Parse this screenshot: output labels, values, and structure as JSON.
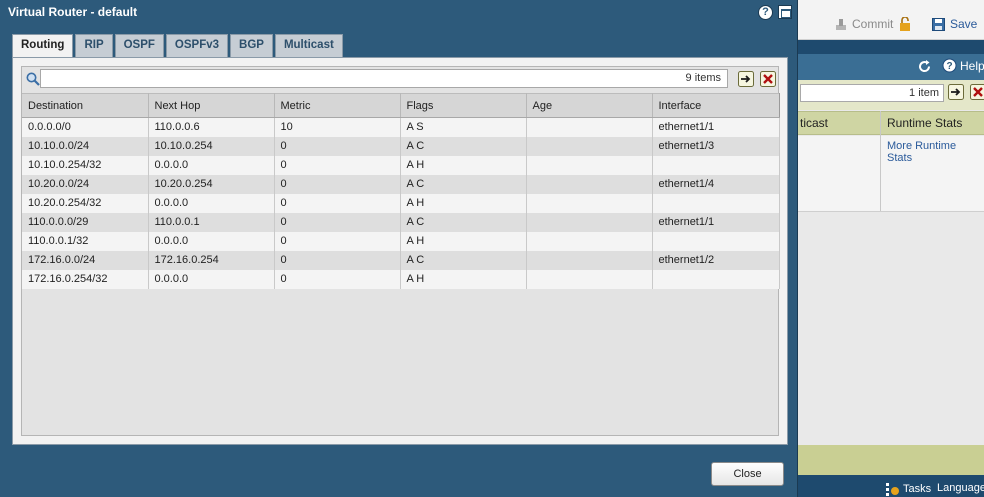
{
  "background": {
    "commit_label": "Commit",
    "save_label": "Save",
    "help_label": "Help",
    "search_count": "1 item",
    "columns": [
      "ticast",
      "Runtime Stats"
    ],
    "runtime_link": "More Runtime Stats",
    "tasks_label": "Tasks",
    "language_label": "Language"
  },
  "modal": {
    "title": "Virtual Router - default",
    "tabs": [
      {
        "label": "Routing",
        "active": true
      },
      {
        "label": "RIP"
      },
      {
        "label": "OSPF"
      },
      {
        "label": "OSPFv3"
      },
      {
        "label": "BGP"
      },
      {
        "label": "Multicast"
      }
    ],
    "search": {
      "value": "",
      "count": "9 items"
    },
    "table": {
      "columns": [
        "Destination",
        "Next Hop",
        "Metric",
        "Flags",
        "Age",
        "Interface"
      ],
      "rows": [
        [
          "0.0.0.0/0",
          "110.0.0.6",
          "10",
          "A S",
          "",
          "ethernet1/1"
        ],
        [
          "10.10.0.0/24",
          "10.10.0.254",
          "0",
          "A C",
          "",
          "ethernet1/3"
        ],
        [
          "10.10.0.254/32",
          "0.0.0.0",
          "0",
          "A H",
          "",
          ""
        ],
        [
          "10.20.0.0/24",
          "10.20.0.254",
          "0",
          "A C",
          "",
          "ethernet1/4"
        ],
        [
          "10.20.0.254/32",
          "0.0.0.0",
          "0",
          "A H",
          "",
          ""
        ],
        [
          "110.0.0.0/29",
          "110.0.0.1",
          "0",
          "A C",
          "",
          "ethernet1/1"
        ],
        [
          "110.0.0.1/32",
          "0.0.0.0",
          "0",
          "A H",
          "",
          ""
        ],
        [
          "172.16.0.0/24",
          "172.16.0.254",
          "0",
          "A C",
          "",
          "ethernet1/2"
        ],
        [
          "172.16.0.254/32",
          "0.0.0.0",
          "0",
          "A H",
          "",
          ""
        ]
      ]
    },
    "close_label": "Close"
  },
  "icons": [
    "commit-icon",
    "lock-icon",
    "save-icon",
    "refresh-icon",
    "help-icon",
    "go-icon",
    "clear-icon",
    "search-icon",
    "maximize-icon",
    "tasks-icon"
  ],
  "colors": {
    "modal_bg": "#2d5a7b",
    "accent_green": "#c9cf93",
    "status_bar": "#1e4a6e"
  }
}
